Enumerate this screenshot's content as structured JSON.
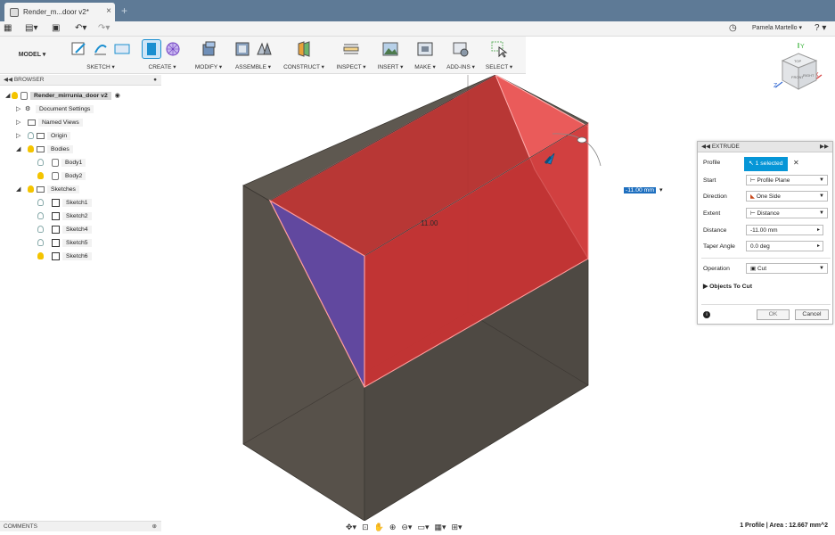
{
  "window": {
    "tab_title": "Render_m...door v2*",
    "tab_close": "×",
    "tab_add": "+",
    "user_name": "Pamela Martello ▾",
    "help": "? ▾"
  },
  "ribbon": {
    "workspace": "MODEL ▾",
    "groups": [
      "SKETCH ▾",
      "CREATE ▾",
      "MODIFY ▾",
      "ASSEMBLE ▾",
      "CONSTRUCT ▾",
      "INSPECT ▾",
      "INSERT ▾",
      "MAKE ▾",
      "ADD-INS ▾",
      "SELECT ▾"
    ]
  },
  "browser": {
    "title": "BROWSER",
    "root": "Render_mirrunia_door v2",
    "items": [
      "Document Settings",
      "Named Views",
      "Origin",
      "Bodies",
      "Body1",
      "Body2",
      "Sketches",
      "Sketch1",
      "Sketch2",
      "Sketch4",
      "Sketch5",
      "Sketch6"
    ]
  },
  "viewport": {
    "dimension_label": "11.00",
    "dimension_input": "-11.00 mm",
    "viewcube_faces": [
      "FRONT",
      "RIGHT",
      "TOP"
    ],
    "axis_labels": [
      "Y",
      "X",
      "Z"
    ]
  },
  "extrude": {
    "title": "EXTRUDE",
    "profile_label": "Profile",
    "profile_value": "1 selected",
    "start_label": "Start",
    "start_value": "Profile Plane",
    "direction_label": "Direction",
    "direction_value": "One Side",
    "extent_label": "Extent",
    "extent_value": "Distance",
    "distance_label": "Distance",
    "distance_value": "-11.00 mm",
    "taper_label": "Taper Angle",
    "taper_value": "0.0 deg",
    "operation_label": "Operation",
    "operation_value": "Cut",
    "objects_to_cut": "Objects To Cut",
    "ok": "OK",
    "cancel": "Cancel"
  },
  "footer": {
    "comments": "COMMENTS",
    "status": "1 Profile | Area : 12.667 mm^2"
  },
  "colors": {
    "titlebar": "#5e7a96",
    "accent": "#0696d7",
    "body_dark": "#58524a",
    "cut_red": "#cc3030",
    "profile_blue": "#5a4aa8"
  }
}
